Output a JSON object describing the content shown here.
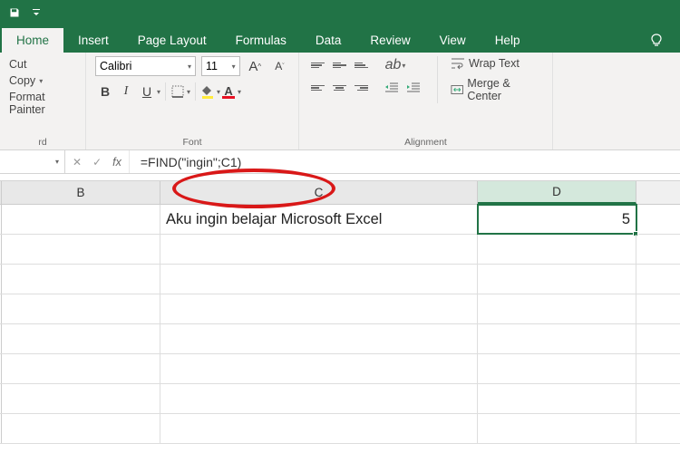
{
  "qat": {
    "save_icon": "save",
    "dropdown_icon": "chevron"
  },
  "tabs": {
    "items": [
      "Home",
      "Insert",
      "Page Layout",
      "Formulas",
      "Data",
      "Review",
      "View",
      "Help"
    ],
    "active": 0
  },
  "ribbon": {
    "clipboard": {
      "cut": "Cut",
      "copy": "Copy",
      "painter": "Format Painter",
      "label": "Clipboard"
    },
    "font": {
      "name": "Calibri",
      "size": "11",
      "bold": "B",
      "italic": "I",
      "underline": "U",
      "grow": "A",
      "shrink": "A",
      "label": "Font"
    },
    "alignment": {
      "wrap": "Wrap Text",
      "merge": "Merge & Center",
      "label": "Alignment"
    }
  },
  "formula_bar": {
    "name_box": "",
    "cancel": "✕",
    "enter": "✓",
    "fx": "fx",
    "formula": "=FIND(\"ingin\";C1)"
  },
  "columns": {
    "B": "B",
    "C": "C",
    "D": "D"
  },
  "cells": {
    "C1": "Aku ingin belajar Microsoft Excel",
    "D1": "5"
  },
  "selected_cell": "D1"
}
